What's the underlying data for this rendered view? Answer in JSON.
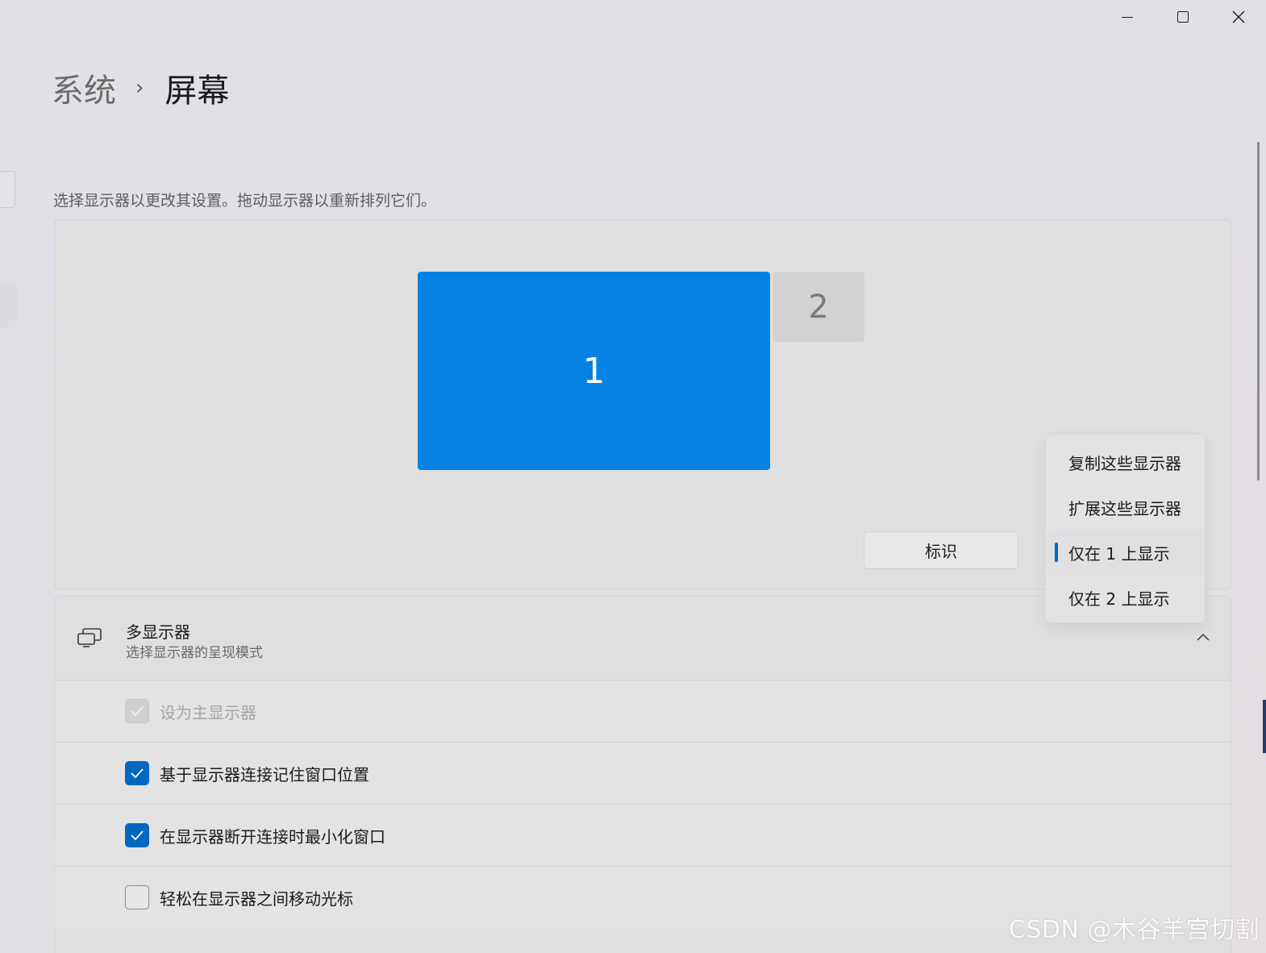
{
  "window_controls": {
    "minimize_icon": "minimize-icon",
    "maximize_icon": "maximize-icon",
    "close_icon": "close-icon"
  },
  "breadcrumb": {
    "parent": "系统",
    "separator": "›",
    "current": "屏幕"
  },
  "hint": "选择显示器以更改其设置。拖动显示器以重新排列它们。",
  "arrangement": {
    "monitors": [
      {
        "label": "1",
        "selected": true,
        "color": "#0582e4"
      },
      {
        "label": "2",
        "selected": false,
        "color": "#d2d2d3"
      }
    ],
    "identify_button": "标识"
  },
  "dropdown": {
    "items": [
      {
        "label": "复制这些显示器",
        "selected": false
      },
      {
        "label": "扩展这些显示器",
        "selected": false
      },
      {
        "label": "仅在 1 上显示",
        "selected": true
      },
      {
        "label": "仅在 2 上显示",
        "selected": false
      }
    ],
    "accent": "#0067c0"
  },
  "multi_display": {
    "icon": "multi-monitor-icon",
    "title": "多显示器",
    "subtitle": "选择显示器的呈现模式",
    "expanded": true,
    "options": [
      {
        "label": "设为主显示器",
        "checked": true,
        "disabled": true
      },
      {
        "label": "基于显示器连接记住窗口位置",
        "checked": true,
        "disabled": false
      },
      {
        "label": "在显示器断开连接时最小化窗口",
        "checked": true,
        "disabled": false
      },
      {
        "label": "轻松在显示器之间移动光标",
        "checked": false,
        "disabled": false
      }
    ]
  },
  "watermark": "CSDN @木谷羊宫切割"
}
